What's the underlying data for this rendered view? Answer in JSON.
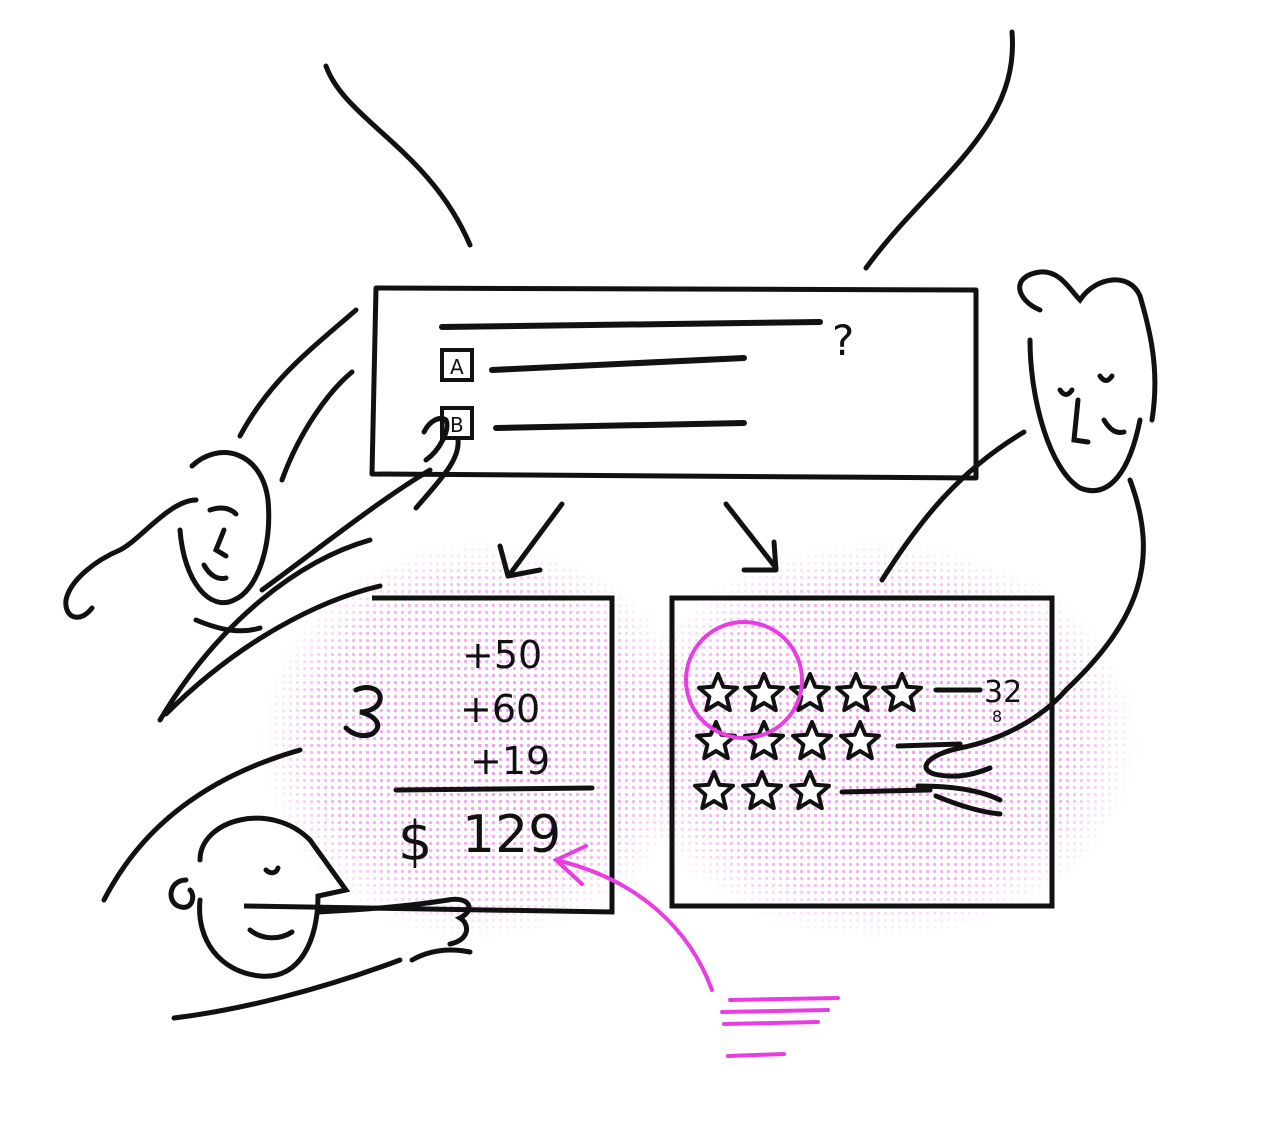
{
  "colors": {
    "ink": "#111111",
    "accent": "#e83de3",
    "halftone": "#f3a6ee",
    "background": "#ffffff"
  },
  "question_card": {
    "question_mark": "?",
    "option_a": "A",
    "option_b": "B"
  },
  "calc_panel": {
    "line_1": "+50",
    "line_2": "+60",
    "line_3": "+19",
    "currency": "$",
    "total": "129"
  },
  "ratings_panel": {
    "top_row_stars": 5,
    "second_row_stars": 4,
    "third_row_stars": 3,
    "top_row_count": "32",
    "second_row_count": "8"
  },
  "icons": [
    "arrow-left-down-icon",
    "arrow-right-down-icon",
    "star-icon",
    "pink-arrow-icon"
  ]
}
